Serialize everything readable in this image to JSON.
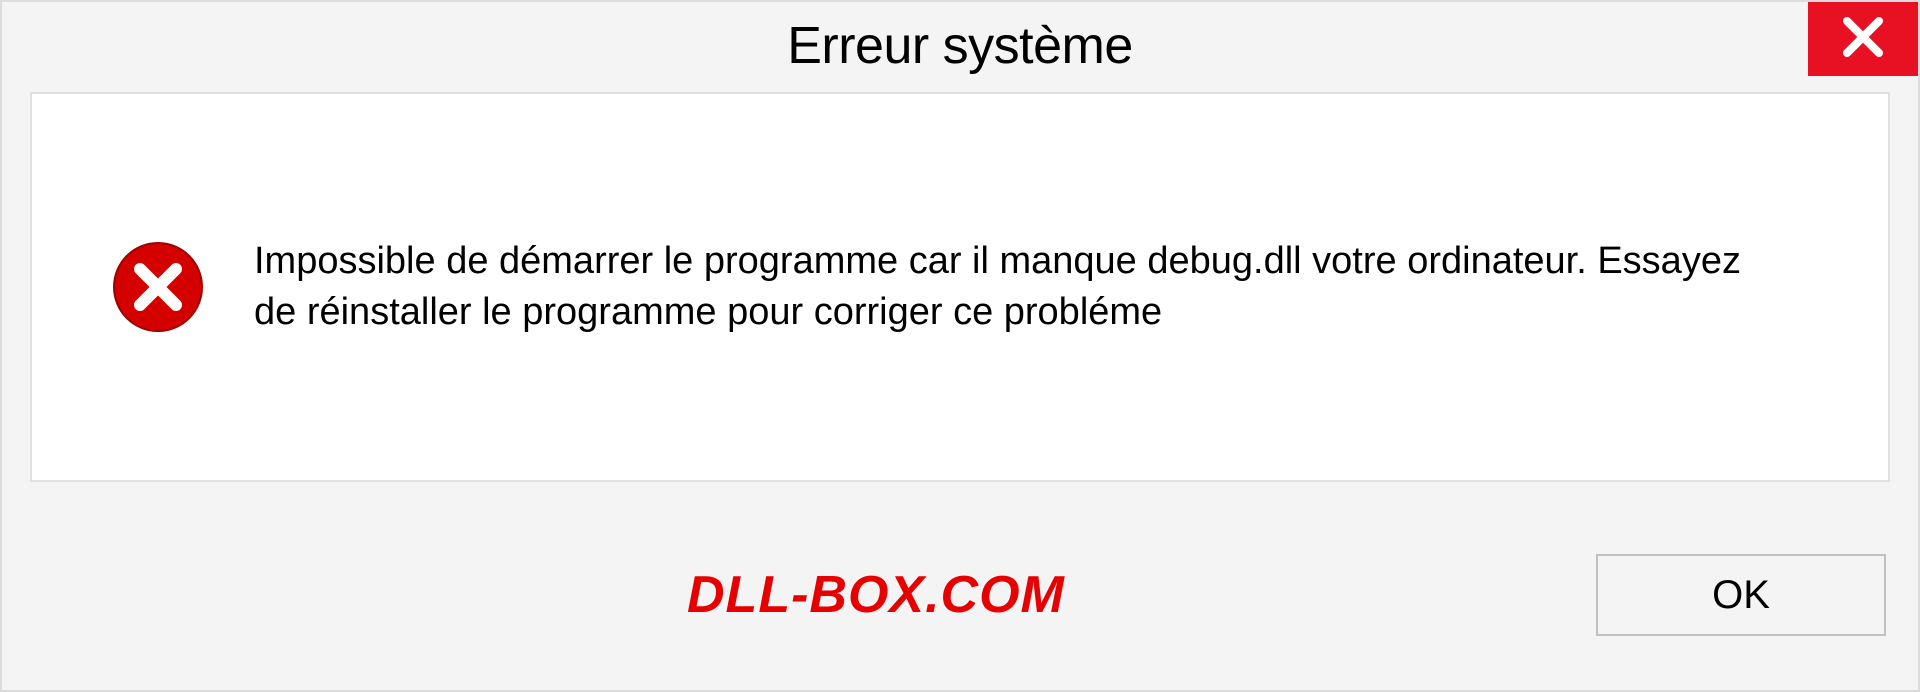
{
  "dialog": {
    "title": "Erreur système",
    "message": "Impossible de démarrer le programme car il manque debug.dll votre ordinateur. Essayez de réinstaller le programme pour corriger ce probléme",
    "ok_label": "OK"
  },
  "watermark": {
    "text": "DLL-BOX.COM"
  },
  "colors": {
    "close_bg": "#e81123",
    "error_icon": "#d40000",
    "watermark": "#e60000"
  }
}
